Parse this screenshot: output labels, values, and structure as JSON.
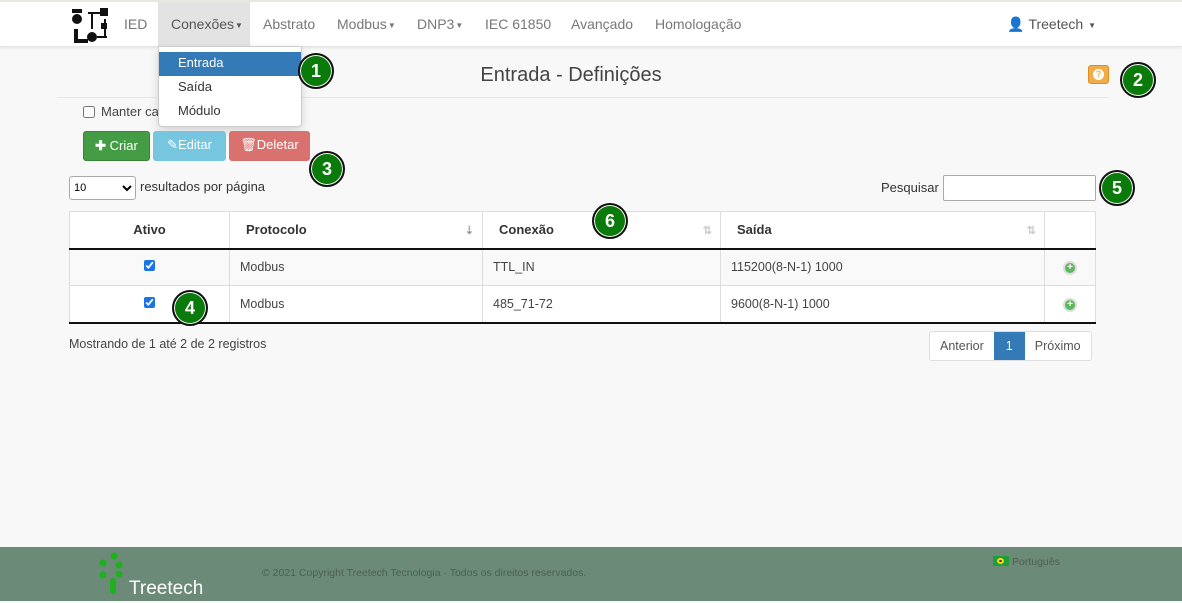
{
  "nav": {
    "items": [
      "IED",
      "Conexões",
      "Abstrato",
      "Modbus",
      "DNP3",
      "IEC 61850",
      "Avançado",
      "Homologação"
    ],
    "user": "Treetech"
  },
  "dropdown": [
    "Entrada",
    "Saída",
    "Módulo"
  ],
  "page": {
    "title": "Entrada - Definições",
    "help": "?",
    "keep_label": "Manter car"
  },
  "buttons": {
    "create": "Criar",
    "edit": "Editar",
    "delete": "Deletar"
  },
  "length": {
    "value": "10",
    "label": "resultados por página"
  },
  "search": {
    "label": "Pesquisar",
    "value": ""
  },
  "table": {
    "headers": [
      "Ativo",
      "Protocolo",
      "Conexão",
      "Saída"
    ],
    "rows": [
      {
        "active": true,
        "protocol": "Modbus",
        "connection": "TTL_IN",
        "output": "115200(8-N-1) 1000"
      },
      {
        "active": true,
        "protocol": "Modbus",
        "connection": "485_71-72",
        "output": "9600(8-N-1) 1000"
      }
    ]
  },
  "info": "Mostrando de 1 até 2 de 2 registros",
  "pagination": {
    "prev": "Anterior",
    "current": "1",
    "next": "Próximo"
  },
  "footer": {
    "brand": "Treetech",
    "copyright": "© 2021 Copyright Treetech Tecnologia · Todos os direitos reservados.",
    "language": "Português"
  },
  "badges": [
    "1",
    "2",
    "3",
    "4",
    "5",
    "6"
  ],
  "colors": {
    "primary": "#337ab7",
    "success": "#5cb85c",
    "info": "#5bc0de",
    "danger": "#d9534f",
    "footer": "#6b8a77",
    "badge": "#0a7a0a"
  }
}
